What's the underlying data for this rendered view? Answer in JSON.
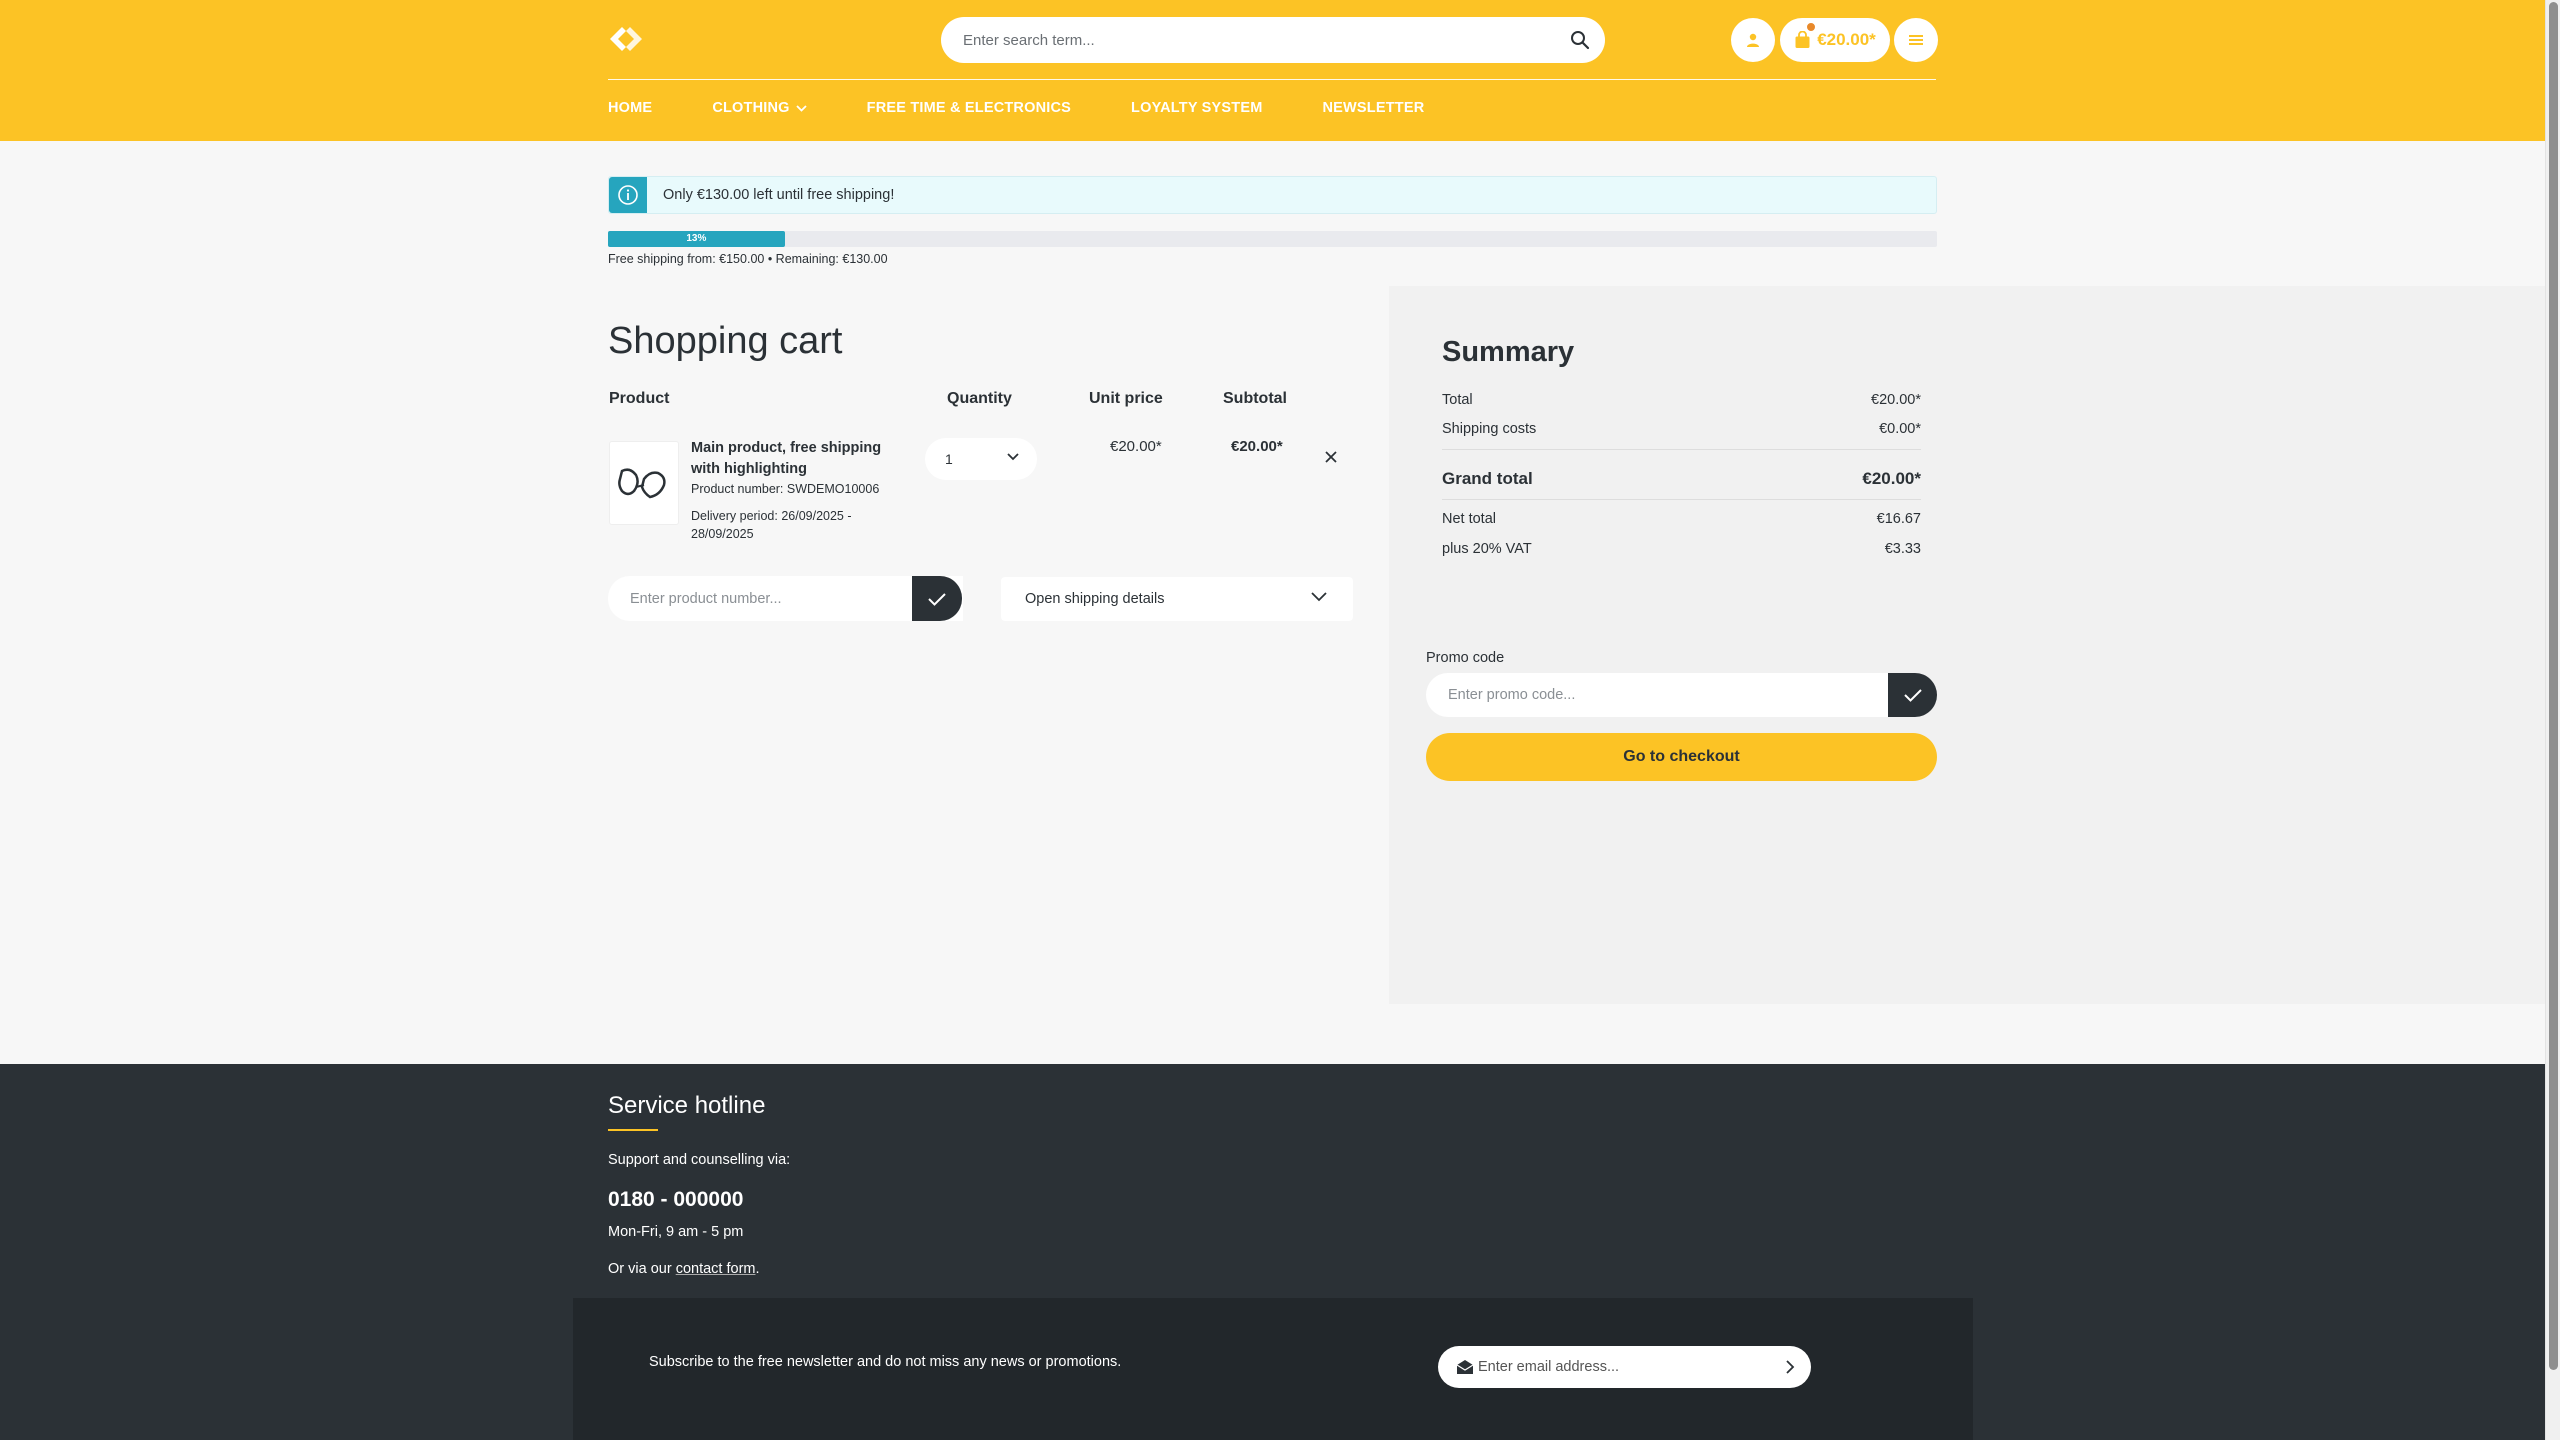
{
  "colors": {
    "brand": "#fcc325",
    "accent": "#26a5be",
    "dark": "#2b3136"
  },
  "header": {
    "search_placeholder": "Enter search term...",
    "cart_total": "€20.00*",
    "nav": [
      {
        "label": "HOME"
      },
      {
        "label": "CLOTHING"
      },
      {
        "label": "FREE TIME & ELECTRONICS"
      },
      {
        "label": "LOYALTY SYSTEM"
      },
      {
        "label": "NEWSLETTER"
      }
    ]
  },
  "shipping_notice": {
    "message": "Only €130.00 left until free shipping!",
    "progress_label": "13%",
    "progress_fraction": 0.133,
    "info": "Free shipping from: €150.00 • Remaining: €130.00"
  },
  "cart": {
    "title": "Shopping cart",
    "columns": {
      "product": "Product",
      "quantity": "Quantity",
      "unit_price": "Unit price",
      "subtotal": "Subtotal"
    },
    "items": [
      {
        "name": "Main product, free shipping with highlighting",
        "product_number": "Product number: SWDEMO10006",
        "delivery": "Delivery period: 26/09/2025 - 28/09/2025",
        "quantity": "1",
        "unit_price": "€20.00*",
        "subtotal": "€20.00*"
      }
    ],
    "product_number_placeholder": "Enter product number...",
    "shipping_details_label": "Open shipping details"
  },
  "summary": {
    "title": "Summary",
    "rows": [
      {
        "label": "Total",
        "value": "€20.00*"
      },
      {
        "label": "Shipping costs",
        "value": "€0.00*"
      }
    ],
    "grand_total": {
      "label": "Grand total",
      "value": "€20.00*"
    },
    "net_total": {
      "label": "Net total",
      "value": "€16.67"
    },
    "vat": {
      "label": "plus 20% VAT",
      "value": "€3.33"
    },
    "promo_label": "Promo code",
    "promo_placeholder": "Enter promo code...",
    "checkout_label": "Go to checkout"
  },
  "footer": {
    "title": "Service hotline",
    "support_text": "Support and counselling via:",
    "phone": "0180 - 000000",
    "hours": "Mon-Fri, 9 am - 5 pm",
    "contact_prefix": "Or via our",
    "contact_link": "contact form",
    "contact_suffix": ".",
    "newsletter_text": "Subscribe to the free newsletter and do not miss any news or promotions.",
    "email_placeholder": "Enter email address..."
  }
}
